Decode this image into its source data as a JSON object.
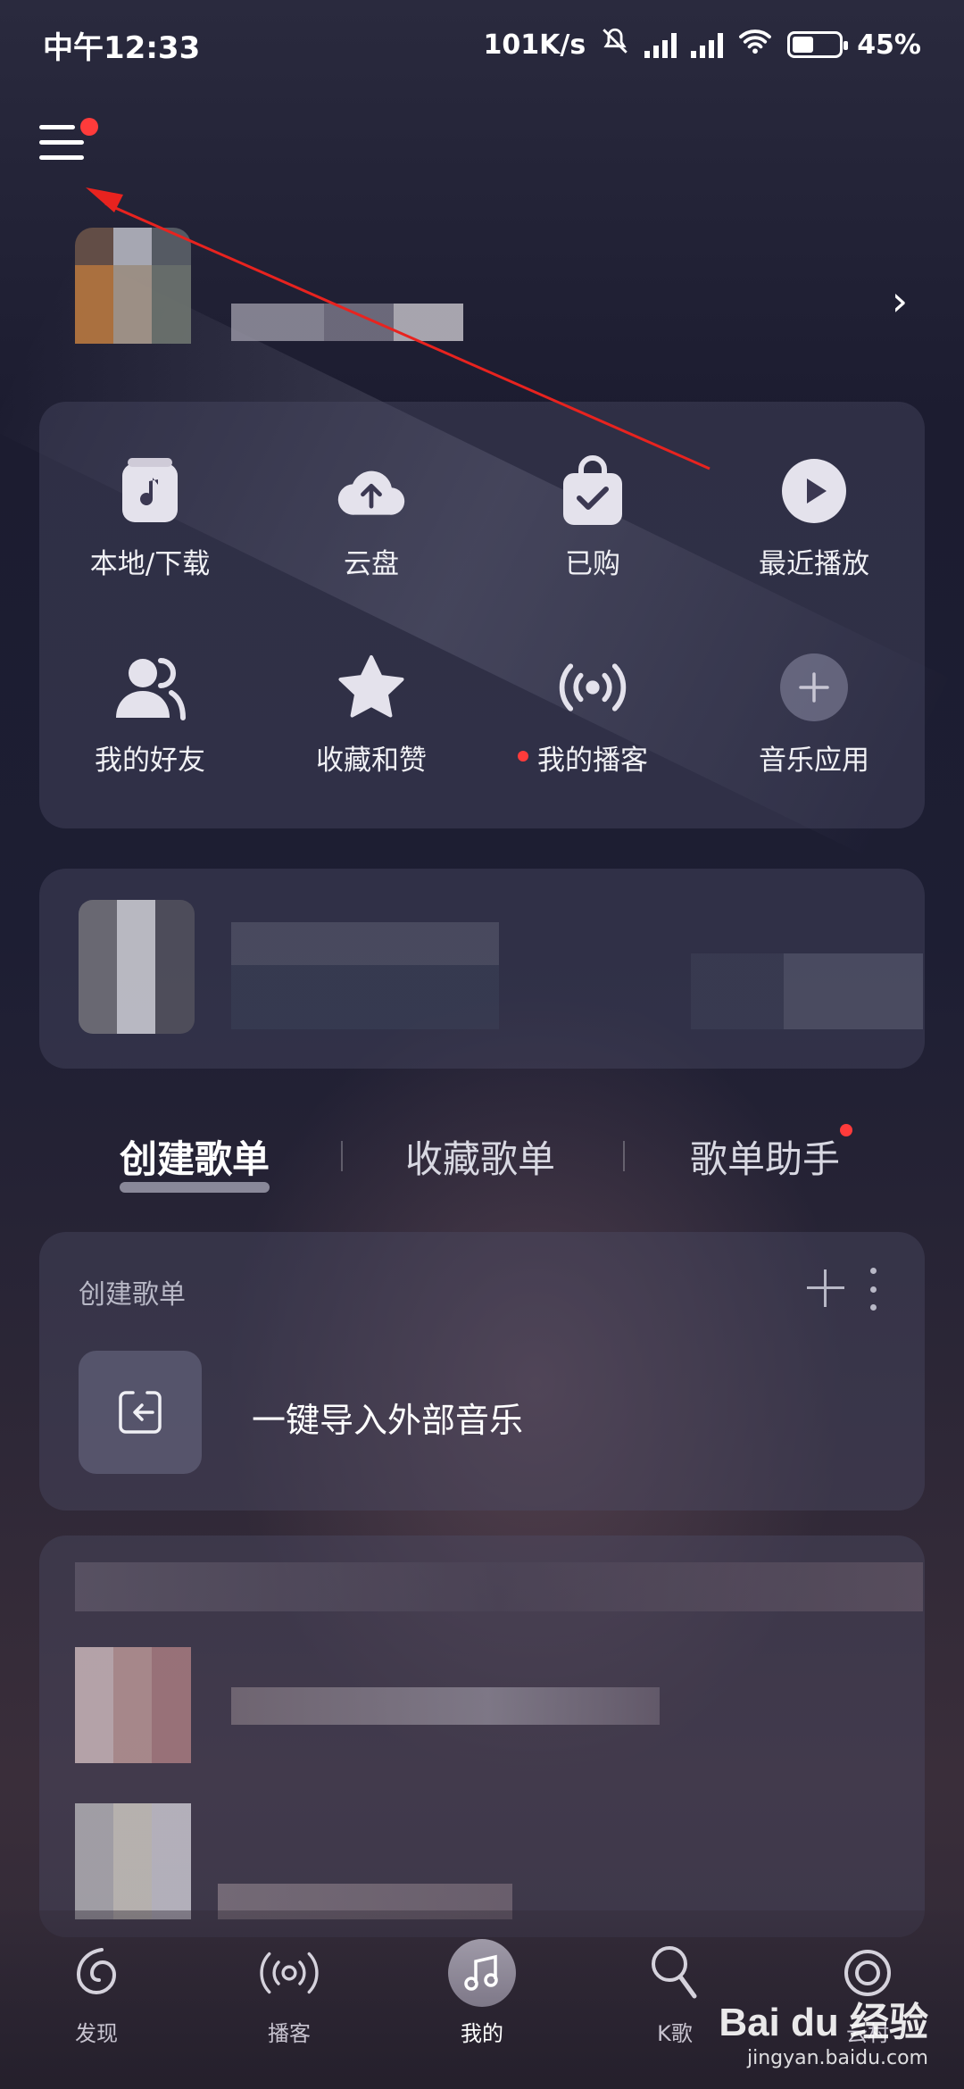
{
  "status_bar": {
    "time": "中午12:33",
    "network_speed": "101K/s",
    "battery_percent": "45%",
    "battery_level": 0.45
  },
  "header": {
    "menu_icon": "menu-icon",
    "notification_dot": true
  },
  "quick_actions": [
    {
      "label": "本地/下载",
      "icon": "music-note-icon"
    },
    {
      "label": "云盘",
      "icon": "cloud-upload-icon"
    },
    {
      "label": "已购",
      "icon": "shopping-bag-check-icon"
    },
    {
      "label": "最近播放",
      "icon": "play-circle-icon"
    },
    {
      "label": "我的好友",
      "icon": "friends-icon"
    },
    {
      "label": "收藏和赞",
      "icon": "star-icon"
    },
    {
      "label": "我的播客",
      "icon": "podcast-icon",
      "dot": true
    },
    {
      "label": "音乐应用",
      "icon": "plus-circle-icon"
    }
  ],
  "playlist_tabs": [
    {
      "label": "创建歌单",
      "active": true
    },
    {
      "label": "收藏歌单",
      "active": false
    },
    {
      "label": "歌单助手",
      "active": false,
      "dot": true
    }
  ],
  "create_section": {
    "title": "创建歌单",
    "import_label": "一键导入外部音乐"
  },
  "bottom_nav": [
    {
      "label": "发现",
      "icon": "discover-icon",
      "active": false
    },
    {
      "label": "播客",
      "icon": "podcast-icon",
      "active": false
    },
    {
      "label": "我的",
      "icon": "music-note-icon",
      "active": true
    },
    {
      "label": "K歌",
      "icon": "microphone-icon",
      "active": false
    },
    {
      "label": "云村",
      "icon": "community-icon",
      "active": false
    }
  ],
  "watermark": {
    "main": "Bai du 经验",
    "sub": "jingyan.baidu.com"
  },
  "colors": {
    "accent_red": "#ff3b3b",
    "arrow_red": "#e8231f"
  }
}
